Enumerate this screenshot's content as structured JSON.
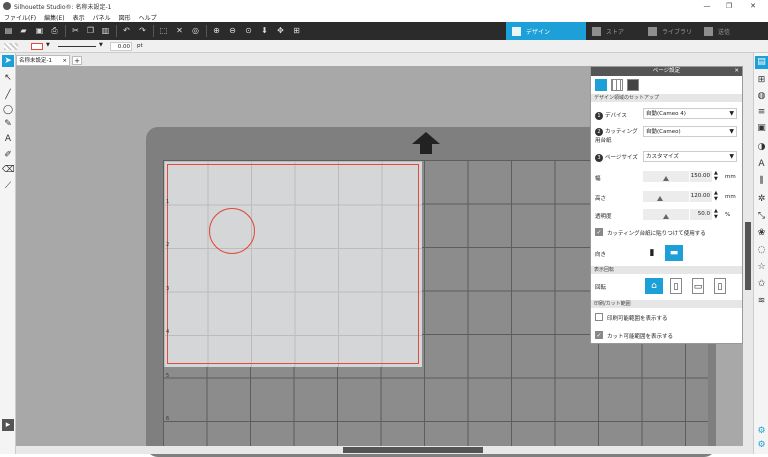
{
  "window": {
    "title": "Silhouette Studio®: 名称未設定-1",
    "controls": [
      "—",
      "❐",
      "✕"
    ]
  },
  "menu": [
    "ファイル(F)",
    "編集(E)",
    "表示",
    "パネル",
    "図形",
    "ヘルプ"
  ],
  "nav_tabs": [
    {
      "label": "デザイン"
    },
    {
      "label": "ストア"
    },
    {
      "label": "ライブラリ"
    },
    {
      "label": "送信"
    }
  ],
  "line_settings": {
    "width_value": "0.00",
    "unit": "pt"
  },
  "doc_tab": {
    "label": "名称未設定-1",
    "close": "×",
    "add": "+"
  },
  "ruler_numbers": [
    "1",
    "2",
    "3",
    "4",
    "5",
    "6"
  ],
  "panel": {
    "title": "ページ設定",
    "close": "✕",
    "section_design": "デザイン領域のセットアップ",
    "device_label": "デバイス",
    "device_value": "自動(Cameo 4)",
    "mat_label": "カッティング用台紙",
    "mat_value": "自動(Cameo)",
    "pagesize_label": "ページサイズ",
    "pagesize_value": "カスタマイズ",
    "width_label": "幅",
    "width_value": "150.00",
    "width_unit": "mm",
    "height_label": "高さ",
    "height_value": "120.00",
    "height_unit": "mm",
    "opacity_label": "透明度",
    "opacity_value": "50.0",
    "opacity_unit": "%",
    "use_mat_label": "カッティング台紙に貼りつけて使用する",
    "orient_label": "向き",
    "section_view": "表示回転",
    "rotate_label": "回転",
    "section_print": "印刷/カット範囲",
    "show_print_label": "印刷可能範囲を表示する",
    "show_cut_label": "カット可能範囲を表示する",
    "num1": "1",
    "num2": "2",
    "num3": "3"
  },
  "colors": {
    "accent": "#1d9fd7",
    "cut_line": "#e04b3a",
    "toolbar": "#2b2b2b"
  }
}
